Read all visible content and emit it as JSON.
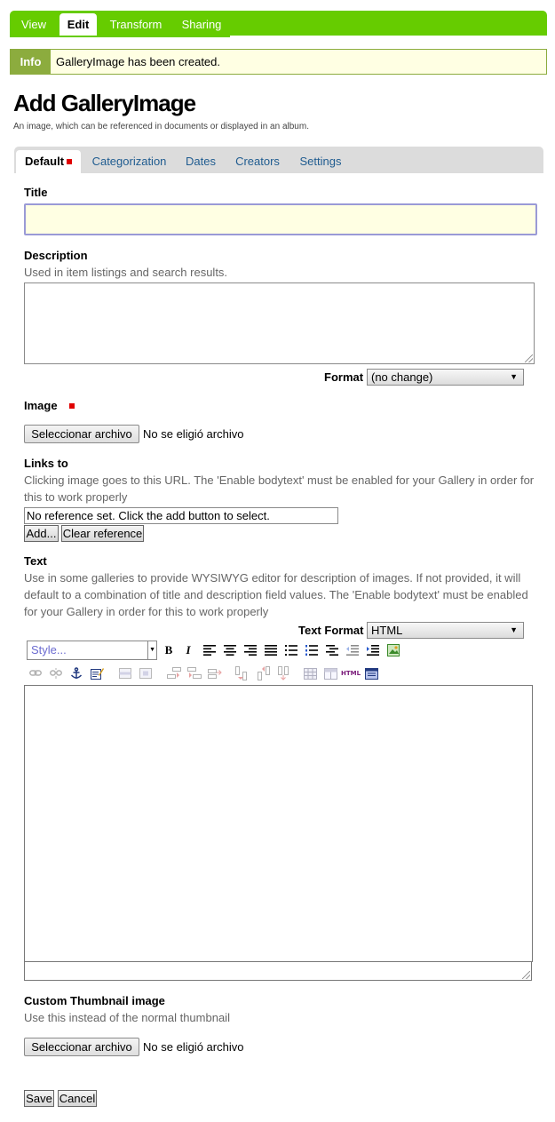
{
  "top_tabs": [
    {
      "label": "View",
      "active": false
    },
    {
      "label": "Edit",
      "active": true
    },
    {
      "label": "Transform",
      "active": false
    },
    {
      "label": "Sharing",
      "active": false
    }
  ],
  "info": {
    "label": "Info",
    "message": "GalleryImage has been created."
  },
  "page": {
    "title": "Add GalleryImage",
    "description": "An image, which can be referenced in documents or displayed in an album."
  },
  "form_tabs": [
    {
      "label": "Default",
      "active": true,
      "required": true
    },
    {
      "label": "Categorization",
      "active": false
    },
    {
      "label": "Dates",
      "active": false
    },
    {
      "label": "Creators",
      "active": false
    },
    {
      "label": "Settings",
      "active": false
    }
  ],
  "fields": {
    "title": {
      "label": "Title",
      "value": ""
    },
    "description": {
      "label": "Description",
      "help": "Used in item listings and search results.",
      "value": "",
      "format_label": "Format",
      "format_value": "(no change)"
    },
    "image": {
      "label": "Image",
      "button": "Seleccionar archivo",
      "status": "No se eligió archivo"
    },
    "links_to": {
      "label": "Links to",
      "help": "Clicking image goes to this URL. The 'Enable bodytext' must be enabled for your Gallery in order for this to work properly",
      "value": "No reference set. Click the add button to select.",
      "add_button": "Add...",
      "clear_button": "Clear reference"
    },
    "text": {
      "label": "Text",
      "help": "Use in some galleries to provide WYSIWYG editor for description of images. If not provided, it will default to a combination of title and description field values. The 'Enable bodytext' must be enabled for your Gallery in order for this to work properly",
      "format_label": "Text Format",
      "format_value": "HTML",
      "style_placeholder": "Style..."
    },
    "thumbnail": {
      "label": "Custom Thumbnail image",
      "help": "Use this instead of the normal thumbnail",
      "button": "Seleccionar archivo",
      "status": "No se eligió archivo"
    }
  },
  "actions": {
    "save": "Save",
    "cancel": "Cancel"
  },
  "colors": {
    "accent": "#66cc00",
    "info_bg": "#ffffe3",
    "info_label": "#8cac3e",
    "link": "#205c90",
    "required": "#e00000"
  }
}
